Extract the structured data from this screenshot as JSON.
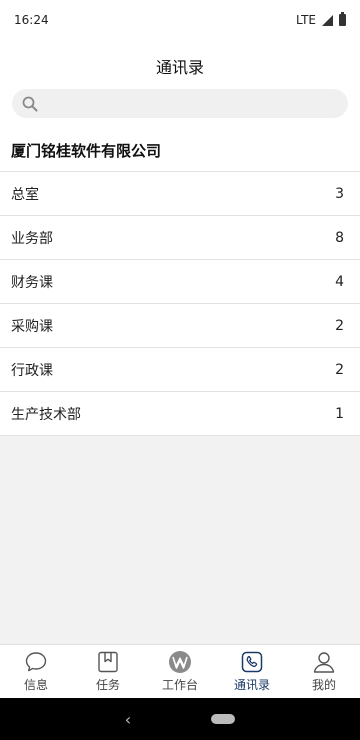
{
  "status": {
    "time": "16:24",
    "network": "LTE"
  },
  "header": {
    "title": "通讯录"
  },
  "search": {
    "placeholder": ""
  },
  "company": {
    "name": "厦门铭桂软件有限公司"
  },
  "departments": [
    {
      "name": "总室",
      "count": "3"
    },
    {
      "name": "业务部",
      "count": "8"
    },
    {
      "name": "财务课",
      "count": "4"
    },
    {
      "name": "采购课",
      "count": "2"
    },
    {
      "name": "行政课",
      "count": "2"
    },
    {
      "name": "生产技术部",
      "count": "1"
    }
  ],
  "tabs": [
    {
      "label": "信息",
      "icon": "chat-bubble-icon"
    },
    {
      "label": "任务",
      "icon": "bookmark-icon"
    },
    {
      "label": "工作台",
      "icon": "workbench-logo-icon"
    },
    {
      "label": "通讯录",
      "icon": "phone-icon",
      "active": true
    },
    {
      "label": "我的",
      "icon": "person-icon"
    }
  ],
  "colors": {
    "active_tab": "#1a3a66",
    "background": "#f2f2f2"
  }
}
